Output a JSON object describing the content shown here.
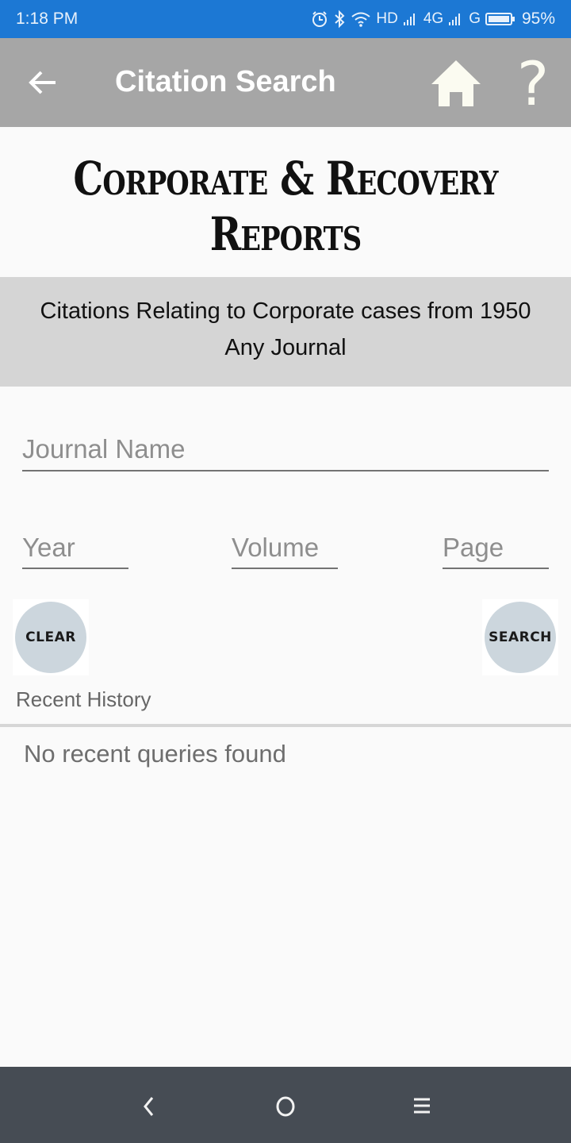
{
  "status_bar": {
    "time": "1:18 PM",
    "icons": [
      "alarm-icon",
      "bluetooth-icon",
      "wifi-icon"
    ],
    "network_hd": "HD",
    "network_4g": "4G",
    "network_g": "G",
    "battery_percent": "95%"
  },
  "app_bar": {
    "title": "Citation Search",
    "back_icon": "arrow-left-icon",
    "home_icon": "home-icon",
    "help_glyph": "?"
  },
  "brand": {
    "line1": "Corporate & Recovery",
    "line2": "Reports"
  },
  "subtitle": {
    "line1": "Citations Relating to Corporate cases from 1950",
    "line2": "Any Journal"
  },
  "form": {
    "journal_placeholder": "Journal Name",
    "journal_value": "",
    "year_placeholder": "Year",
    "year_value": "",
    "volume_placeholder": "Volume",
    "volume_value": "",
    "page_placeholder": "Page",
    "page_value": "",
    "clear_label": "CLEAR",
    "search_label": "SEARCH"
  },
  "history": {
    "label": "Recent History",
    "empty_message": "No recent queries found",
    "items": []
  },
  "colors": {
    "status_bar": "#1c78d4",
    "app_bar": "#a6a6a6",
    "subtitle_band": "#d5d5d5",
    "button_circle": "#ccd6dd",
    "nav_bar": "#464c54"
  }
}
